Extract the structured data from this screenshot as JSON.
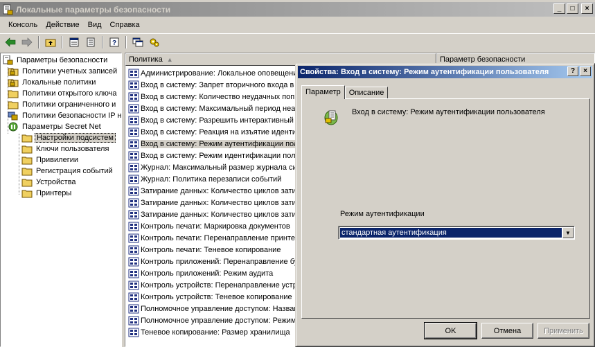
{
  "window": {
    "title": "Локальные параметры безопасности",
    "min": "_",
    "max": "□",
    "close": "×"
  },
  "menu": [
    "Консоль",
    "Действие",
    "Вид",
    "Справка"
  ],
  "tree": {
    "root": "Параметры безопасности",
    "items": [
      "Политики учетных записей",
      "Локальные политики",
      "Политики открытого ключа",
      "Политики ограниченного и",
      "Политики безопасности IP н",
      "Параметры Secret Net"
    ],
    "children": [
      "Настройки подсистем",
      "Ключи пользователя",
      "Привилегии",
      "Регистрация событий",
      "Устройства",
      "Принтеры"
    ]
  },
  "list": {
    "columns": [
      "Политика",
      "Параметр безопасности"
    ],
    "sort_arrow": "▲",
    "rows": [
      "Администрирование: Локальное оповещени",
      "Вход в систему: Запрет вторичного входа в",
      "Вход в систему: Количество неудачных поп",
      "Вход в систему: Максимальный период неак",
      "Вход в систему: Разрешить интерактивный",
      "Вход в систему: Реакция на изъятие иденти",
      "Вход в систему: Режим аутентификации пол",
      "Вход в систему: Режим идентификации польз",
      "Журнал: Максимальный размер журнала сис",
      "Журнал: Политика перезаписи событий",
      "Затирание данных: Количество циклов зати",
      "Затирание данных: Количество циклов зати",
      "Затирание данных: Количество циклов зати",
      "Контроль печати: Маркировка документов",
      "Контроль печати: Перенаправление принте",
      "Контроль печати: Теневое копирование",
      "Контроль приложений: Перенаправление бу",
      "Контроль приложений: Режим аудита",
      "Контроль устройств: Перенаправление устр",
      "Контроль устройств: Теневое копирование",
      "Полномочное управление доступом: Назван",
      "Полномочное управление доступом: Режим р",
      "Теневое копирование: Размер хранилища"
    ]
  },
  "dialog": {
    "title": "Свойства: Вход в систему: Режим аутентификации пользователя",
    "help": "?",
    "close": "×",
    "tabs": [
      "Параметр",
      "Описание"
    ],
    "heading": "Вход в систему: Режим аутентификации пользователя",
    "field_label": "Режим аутентификации",
    "combo_value": "стандартная аутентификация",
    "combo_arrow": "▼",
    "buttons": {
      "ok": "OK",
      "cancel": "Отмена",
      "apply": "Применить"
    }
  },
  "colors": {
    "title_active": "#0a246a",
    "title_inactive": "#808080",
    "face": "#d4d0c8"
  }
}
